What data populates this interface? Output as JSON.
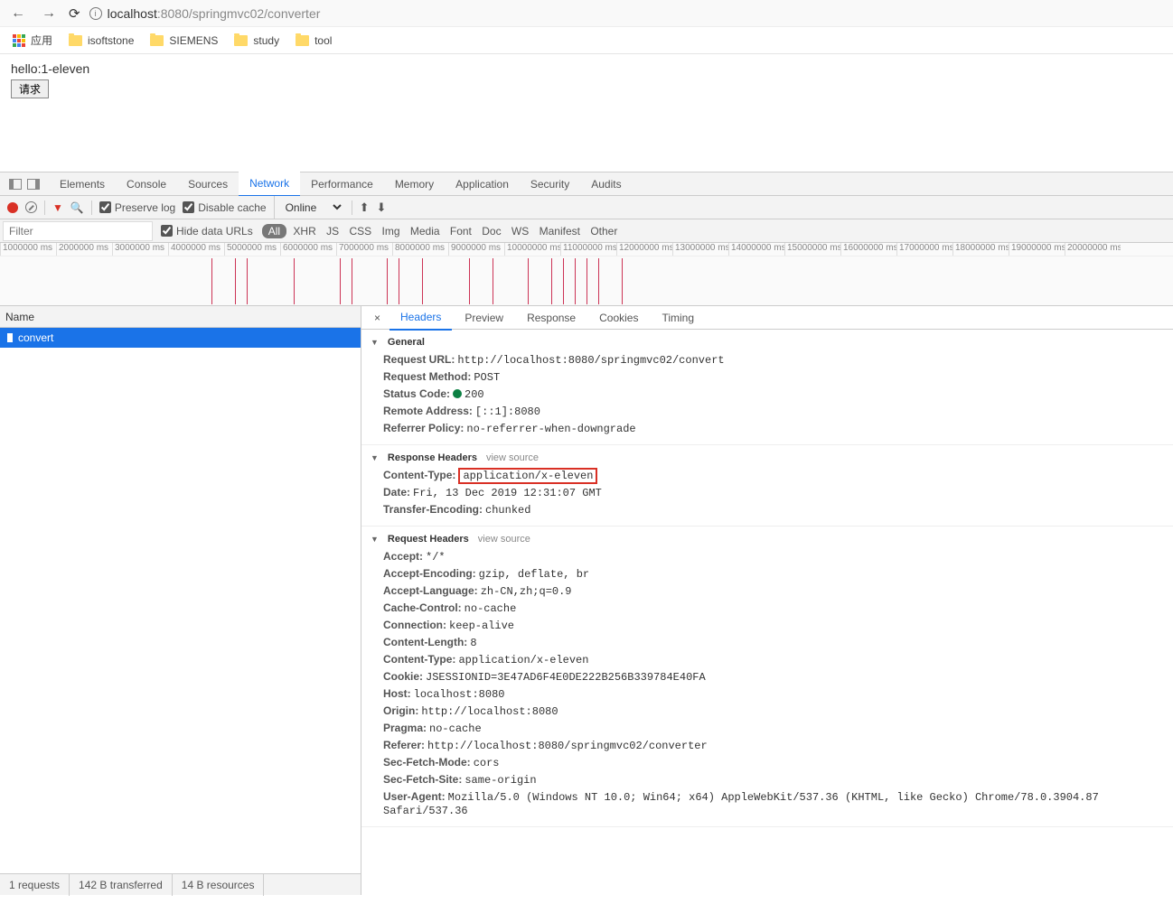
{
  "browser": {
    "url_host": "localhost",
    "url_port": ":8080",
    "url_path": "/springmvc02/converter"
  },
  "bookmarks": {
    "apps_label": "应用",
    "items": [
      "isoftstone",
      "SIEMENS",
      "study",
      "tool"
    ]
  },
  "page": {
    "hello_text": "hello:1-eleven",
    "button_label": "请求"
  },
  "devtools": {
    "tabs": [
      "Elements",
      "Console",
      "Sources",
      "Network",
      "Performance",
      "Memory",
      "Application",
      "Security",
      "Audits"
    ],
    "active_tab": "Network",
    "preserve_log": "Preserve log",
    "disable_cache": "Disable cache",
    "throttle": "Online",
    "filter_placeholder": "Filter",
    "hide_data_urls": "Hide data URLs",
    "filter_types": [
      "All",
      "XHR",
      "JS",
      "CSS",
      "Img",
      "Media",
      "Font",
      "Doc",
      "WS",
      "Manifest",
      "Other"
    ],
    "timeline_ticks": [
      "1000000 ms",
      "2000000 ms",
      "3000000 ms",
      "4000000 ms",
      "5000000 ms",
      "6000000 ms",
      "7000000 ms",
      "8000000 ms",
      "9000000 ms",
      "10000000 ms",
      "11000000 ms",
      "12000000 ms",
      "13000000 ms",
      "14000000 ms",
      "15000000 ms",
      "16000000 ms",
      "17000000 ms",
      "18000000 ms",
      "19000000 ms",
      "20000000 ms"
    ]
  },
  "request_list": {
    "header": "Name",
    "rows": [
      "convert"
    ]
  },
  "detail": {
    "tabs": [
      "Headers",
      "Preview",
      "Response",
      "Cookies",
      "Timing"
    ],
    "general_title": "General",
    "general": {
      "request_url_k": "Request URL:",
      "request_url_v": "http://localhost:8080/springmvc02/convert",
      "request_method_k": "Request Method:",
      "request_method_v": "POST",
      "status_code_k": "Status Code:",
      "status_code_v": "200",
      "remote_addr_k": "Remote Address:",
      "remote_addr_v": "[::1]:8080",
      "referrer_policy_k": "Referrer Policy:",
      "referrer_policy_v": "no-referrer-when-downgrade"
    },
    "response_headers_title": "Response Headers",
    "view_source": "view source",
    "response_headers": {
      "content_type_k": "Content-Type:",
      "content_type_v": "application/x-eleven",
      "date_k": "Date:",
      "date_v": "Fri, 13 Dec 2019 12:31:07 GMT",
      "transfer_encoding_k": "Transfer-Encoding:",
      "transfer_encoding_v": "chunked"
    },
    "request_headers_title": "Request Headers",
    "request_headers": {
      "accept_k": "Accept:",
      "accept_v": "*/*",
      "accept_encoding_k": "Accept-Encoding:",
      "accept_encoding_v": "gzip, deflate, br",
      "accept_language_k": "Accept-Language:",
      "accept_language_v": "zh-CN,zh;q=0.9",
      "cache_control_k": "Cache-Control:",
      "cache_control_v": "no-cache",
      "connection_k": "Connection:",
      "connection_v": "keep-alive",
      "content_length_k": "Content-Length:",
      "content_length_v": "8",
      "content_type_k": "Content-Type:",
      "content_type_v": "application/x-eleven",
      "cookie_k": "Cookie:",
      "cookie_v": "JSESSIONID=3E47AD6F4E0DE222B256B339784E40FA",
      "host_k": "Host:",
      "host_v": "localhost:8080",
      "origin_k": "Origin:",
      "origin_v": "http://localhost:8080",
      "pragma_k": "Pragma:",
      "pragma_v": "no-cache",
      "referer_k": "Referer:",
      "referer_v": "http://localhost:8080/springmvc02/converter",
      "sec_fetch_mode_k": "Sec-Fetch-Mode:",
      "sec_fetch_mode_v": "cors",
      "sec_fetch_site_k": "Sec-Fetch-Site:",
      "sec_fetch_site_v": "same-origin",
      "user_agent_k": "User-Agent:",
      "user_agent_v": "Mozilla/5.0 (Windows NT 10.0; Win64; x64) AppleWebKit/537.36 (KHTML, like Gecko) Chrome/78.0.3904.87 Safari/537.36"
    }
  },
  "status_bar": {
    "requests": "1 requests",
    "transferred": "142 B transferred",
    "resources": "14 B resources"
  }
}
